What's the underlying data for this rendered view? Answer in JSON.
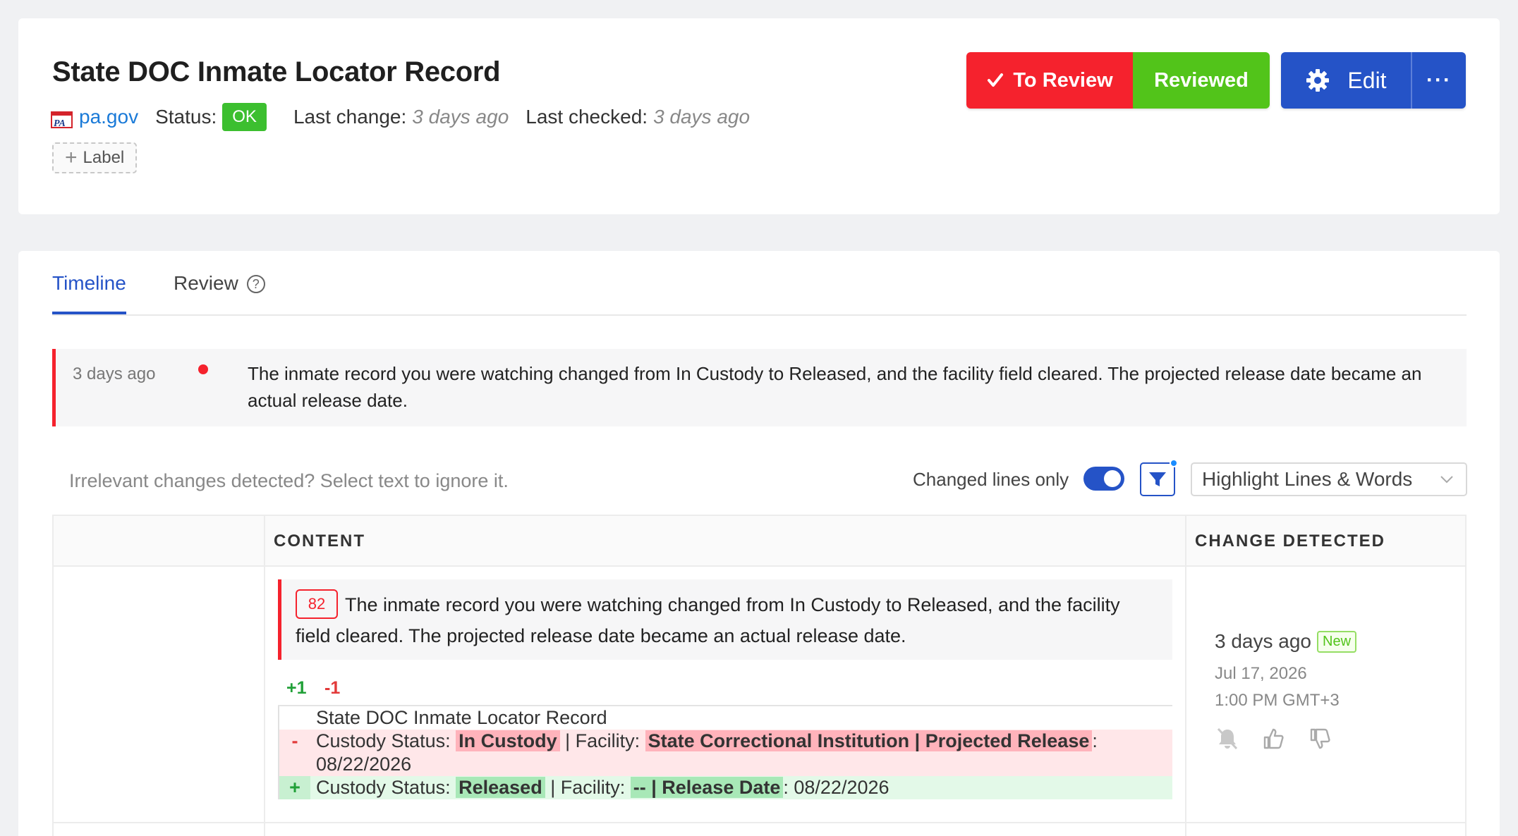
{
  "header": {
    "title": "State DOC Inmate Locator Record",
    "site": "pa.gov",
    "status_label": "Status:",
    "status_value": "OK",
    "last_change_label": "Last change:",
    "last_change_value": "3 days ago",
    "last_checked_label": "Last checked:",
    "last_checked_value": "3 days ago",
    "add_label": "Label",
    "buttons": {
      "to_review": "To Review",
      "reviewed": "Reviewed",
      "edit": "Edit",
      "more": "···"
    }
  },
  "tabs": {
    "timeline": "Timeline",
    "review": "Review",
    "help": "?"
  },
  "timeline_item": {
    "time": "3 days ago",
    "text": "The inmate record you were watching changed from In Custody to Released, and the facility field cleared. The projected release date became an actual release date."
  },
  "toolbar": {
    "hint": "Irrelevant changes detected? Select text to ignore it.",
    "toggle_label": "Changed lines only",
    "highlight_mode": "Highlight Lines & Words"
  },
  "table": {
    "headers": {
      "content": "CONTENT",
      "change_detected": "CHANGE DETECTED"
    },
    "row": {
      "count": "82",
      "summary": "The inmate record you were watching changed from In Custody to Released, and the facility field cleared. The projected release date became an actual release date.",
      "plus": "+1",
      "minus": "-1",
      "diff": {
        "context": "State DOC Inmate Locator Record",
        "del_sign": "-",
        "del_prefix": "Custody Status: ",
        "del_hl1": "In Custody",
        "del_mid": " | Facility: ",
        "del_hl2": "State Correctional Institution | Projected Release",
        "del_suffix": ": 08/22/2026",
        "add_sign": "+",
        "add_prefix": "Custody Status: ",
        "add_hl1": "Released",
        "add_mid": " | Facility: ",
        "add_hl2": "-- | Release Date",
        "add_suffix": ": 08/22/2026"
      },
      "detected_time": "3 days ago",
      "new_tag": "New",
      "date": "Jul 17, 2026",
      "clock": "1:00 PM GMT+3"
    }
  },
  "colors": {
    "accent": "#2553c7",
    "danger": "#f5222d",
    "success": "#52c41a"
  }
}
